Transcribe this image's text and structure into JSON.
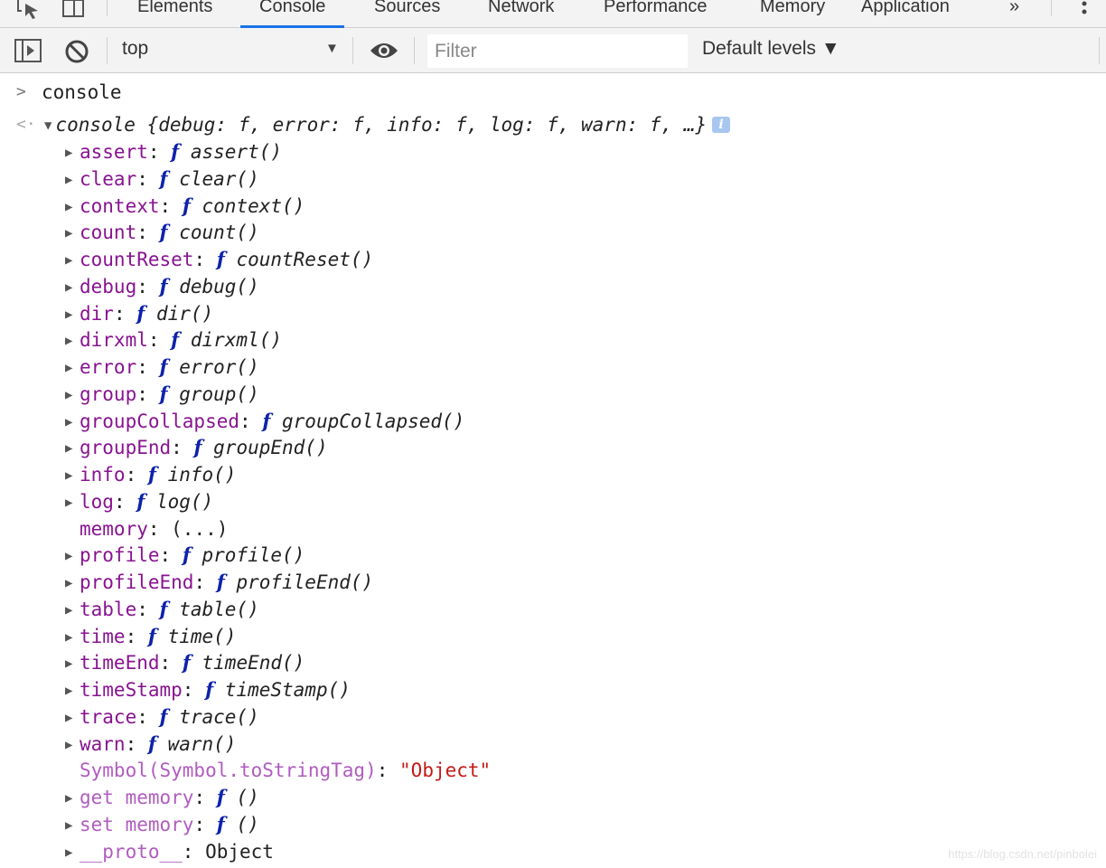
{
  "tabs": [
    {
      "label": "Elements"
    },
    {
      "label": "Console",
      "active": true
    },
    {
      "label": "Sources"
    },
    {
      "label": "Network"
    },
    {
      "label": "Performance"
    },
    {
      "label": "Memory"
    },
    {
      "label": "Application"
    }
  ],
  "more_tabs_label": "»",
  "toolbar": {
    "context": "top",
    "filter_placeholder": "Filter",
    "levels": "Default levels ▼"
  },
  "console": {
    "input": "console",
    "summary": "console {debug: f, error: f, info: f, log: f, warn: f, …}",
    "info_badge": "i",
    "properties": [
      {
        "key": "assert",
        "value": "assert()",
        "type": "function"
      },
      {
        "key": "clear",
        "value": "clear()",
        "type": "function"
      },
      {
        "key": "context",
        "value": "context()",
        "type": "function"
      },
      {
        "key": "count",
        "value": "count()",
        "type": "function"
      },
      {
        "key": "countReset",
        "value": "countReset()",
        "type": "function"
      },
      {
        "key": "debug",
        "value": "debug()",
        "type": "function"
      },
      {
        "key": "dir",
        "value": "dir()",
        "type": "function"
      },
      {
        "key": "dirxml",
        "value": "dirxml()",
        "type": "function"
      },
      {
        "key": "error",
        "value": "error()",
        "type": "function"
      },
      {
        "key": "group",
        "value": "group()",
        "type": "function"
      },
      {
        "key": "groupCollapsed",
        "value": "groupCollapsed()",
        "type": "function"
      },
      {
        "key": "groupEnd",
        "value": "groupEnd()",
        "type": "function"
      },
      {
        "key": "info",
        "value": "info()",
        "type": "function"
      },
      {
        "key": "log",
        "value": "log()",
        "type": "function"
      },
      {
        "key": "memory",
        "value": "(...)",
        "type": "getter"
      },
      {
        "key": "profile",
        "value": "profile()",
        "type": "function"
      },
      {
        "key": "profileEnd",
        "value": "profileEnd()",
        "type": "function"
      },
      {
        "key": "table",
        "value": "table()",
        "type": "function"
      },
      {
        "key": "time",
        "value": "time()",
        "type": "function"
      },
      {
        "key": "timeEnd",
        "value": "timeEnd()",
        "type": "function"
      },
      {
        "key": "timeStamp",
        "value": "timeStamp()",
        "type": "function"
      },
      {
        "key": "trace",
        "value": "trace()",
        "type": "function"
      },
      {
        "key": "warn",
        "value": "warn()",
        "type": "function"
      },
      {
        "key": "Symbol(Symbol.toStringTag)",
        "value": "\"Object\"",
        "type": "string"
      },
      {
        "key": "get memory",
        "value": "()",
        "type": "accessor"
      },
      {
        "key": "set memory",
        "value": "()",
        "type": "accessor"
      },
      {
        "key": "__proto__",
        "value": "Object",
        "type": "object"
      }
    ],
    "function_glyph": "f"
  },
  "watermark": "https://blog.csdn.net/pinbolei",
  "colors": {
    "key": "#881391",
    "key_dim": "#b05cbf",
    "function_glyph": "#0d22aa",
    "string": "#c41a16",
    "active_tab": "#1a73e8"
  }
}
